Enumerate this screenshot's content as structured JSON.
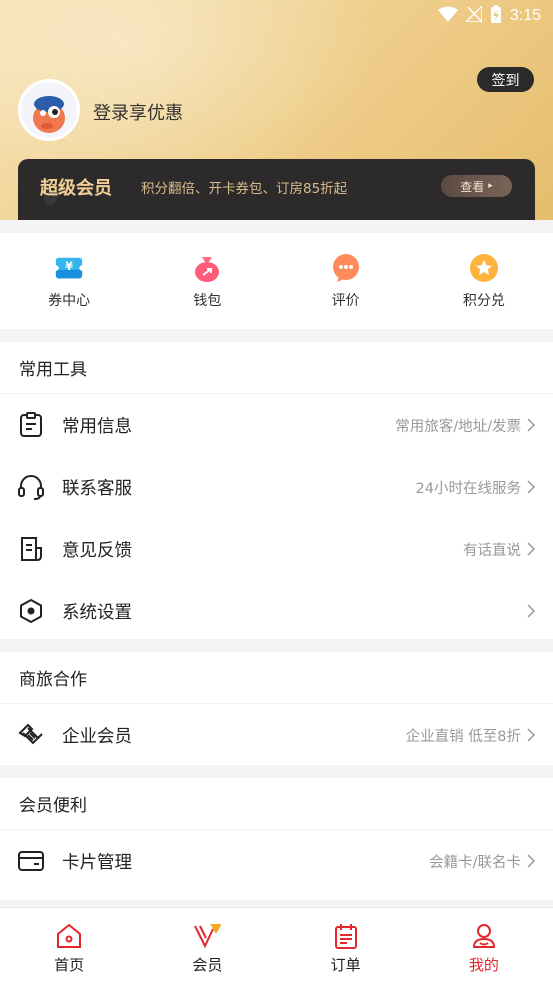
{
  "status_bar": {
    "time": "3:15"
  },
  "header": {
    "checkin_label": "签到",
    "login_text": "登录享优惠"
  },
  "vip": {
    "title": "超级会员",
    "desc": "积分翻倍、开卡券包、订房85折起",
    "button": "查看",
    "button_arrow": "▸"
  },
  "quick": [
    {
      "label": "券中心",
      "icon": "coupon-icon"
    },
    {
      "label": "钱包",
      "icon": "wallet-icon"
    },
    {
      "label": "评价",
      "icon": "review-icon"
    },
    {
      "label": "积分兑",
      "icon": "points-icon"
    }
  ],
  "tools": {
    "title": "常用工具",
    "rows": [
      {
        "label": "常用信息",
        "sub": "常用旅客/地址/发票",
        "icon": "clipboard-icon"
      },
      {
        "label": "联系客服",
        "sub": "24小时在线服务",
        "icon": "headset-icon"
      },
      {
        "label": "意见反馈",
        "sub": "有话直说",
        "icon": "feedback-icon"
      },
      {
        "label": "系统设置",
        "sub": "",
        "icon": "settings-icon"
      }
    ]
  },
  "business": {
    "title": "商旅合作",
    "rows": [
      {
        "label": "企业会员",
        "sub": "企业直销 低至8折",
        "icon": "handshake-icon"
      }
    ]
  },
  "benefits": {
    "title": "会员便利",
    "rows": [
      {
        "label": "卡片管理",
        "sub": "会籍卡/联名卡",
        "icon": "card-icon"
      }
    ]
  },
  "tabs": [
    {
      "label": "首页",
      "icon": "home-icon",
      "active": false
    },
    {
      "label": "会员",
      "icon": "vip-icon",
      "active": false
    },
    {
      "label": "订单",
      "icon": "order-icon",
      "active": false
    },
    {
      "label": "我的",
      "icon": "profile-icon",
      "active": true
    }
  ],
  "colors": {
    "accent": "#e4262e",
    "gold": "#f2cf94",
    "vip_bg": "#2c2a2b"
  }
}
